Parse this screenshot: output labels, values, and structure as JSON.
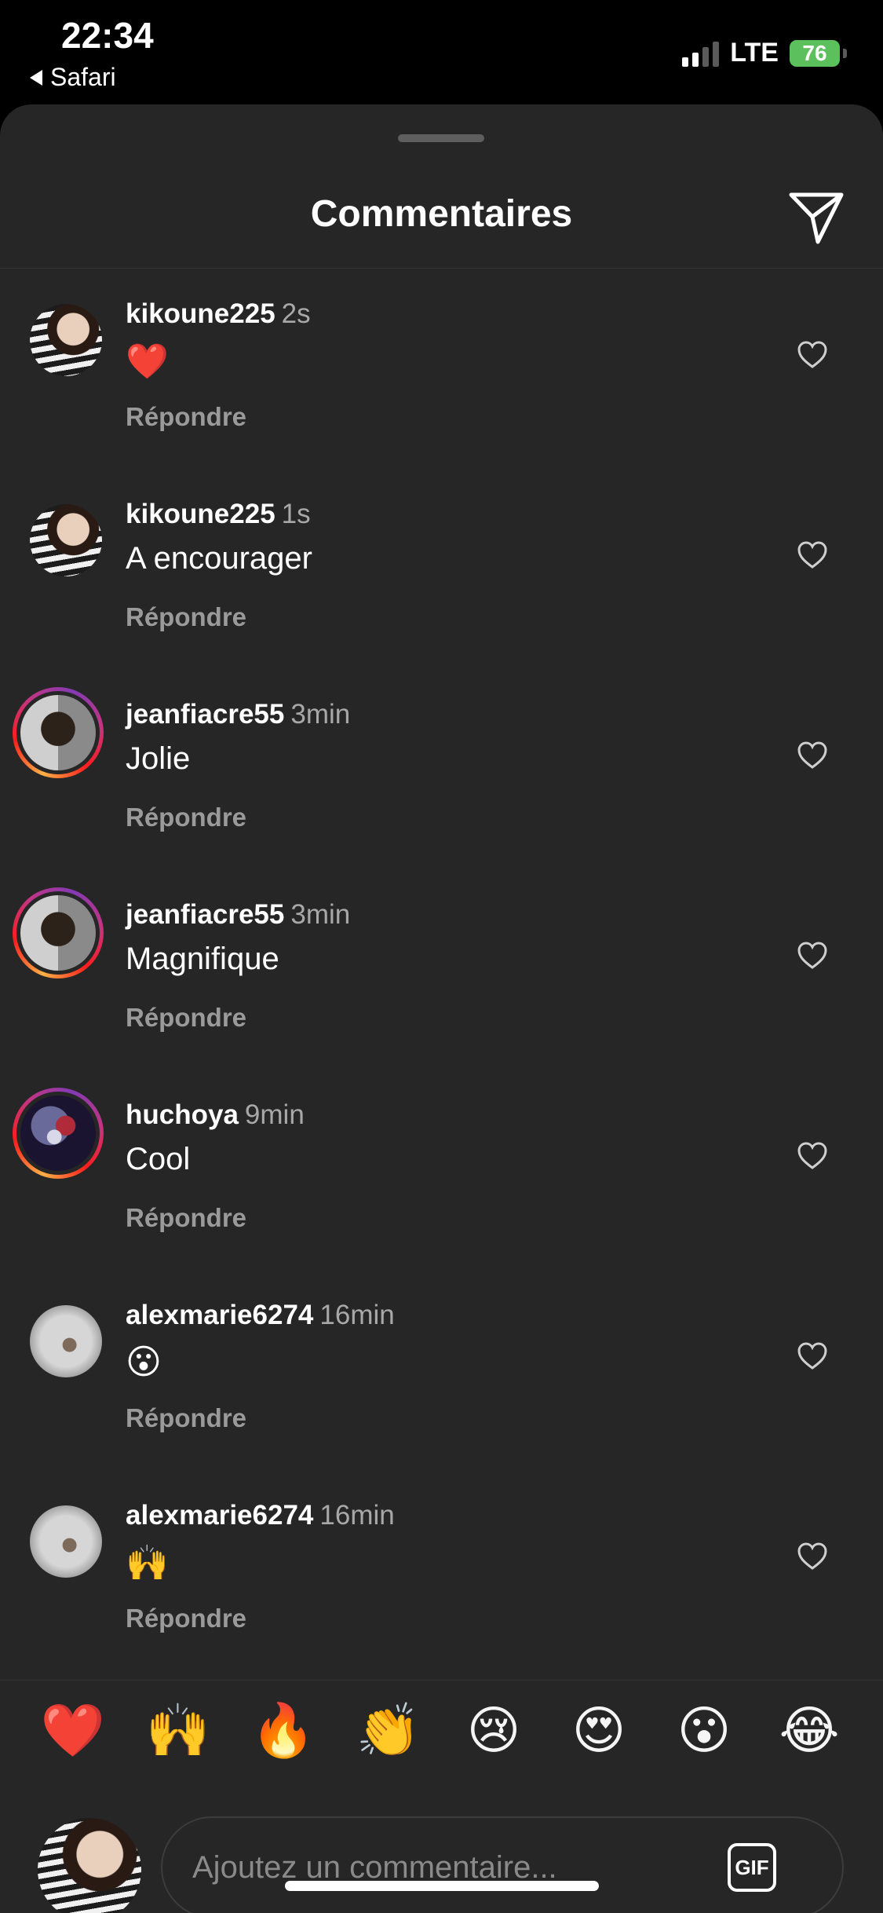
{
  "status": {
    "time": "22:34",
    "back_label": "Safari",
    "network": "LTE",
    "battery": "76",
    "signal_bars": 4,
    "signal_bars_active": 2
  },
  "header": {
    "title": "Commentaires"
  },
  "comments": [
    {
      "user": "kikoune225",
      "time": "2s",
      "text": "❤️",
      "reply": "Répondre"
    },
    {
      "user": "kikoune225",
      "time": "1s",
      "text": "A encourager",
      "reply": "Répondre"
    },
    {
      "user": "jeanfiacre55",
      "time": "3min",
      "text": "Jolie",
      "reply": "Répondre"
    },
    {
      "user": "jeanfiacre55",
      "time": "3min",
      "text": "Magnifique",
      "reply": "Répondre"
    },
    {
      "user": "huchoya",
      "time": "9min",
      "text": "Cool",
      "reply": "Répondre"
    },
    {
      "user": "alexmarie6274",
      "time": "16min",
      "text": "😮",
      "reply": "Répondre"
    },
    {
      "user": "alexmarie6274",
      "time": "16min",
      "text": "🙌",
      "reply": "Répondre"
    }
  ],
  "quick_emojis": [
    "❤️",
    "🙌",
    "🔥",
    "👏",
    "😢",
    "😍",
    "😮",
    "😂"
  ],
  "composer": {
    "placeholder": "Ajoutez un commentaire...",
    "gif_label": "GIF"
  },
  "colors": {
    "sheet_bg": "#262626",
    "muted_text": "#a8a8a8",
    "battery_green": "#5cc15c"
  }
}
